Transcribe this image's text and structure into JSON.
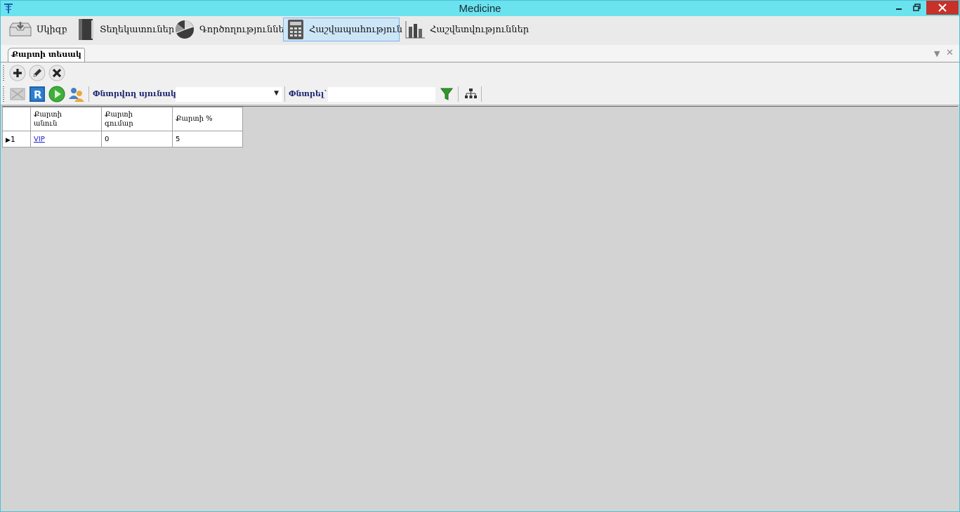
{
  "window": {
    "title": "Medicine",
    "accent_color": "#6ae3ee",
    "close_color": "#c7312a"
  },
  "menu": {
    "items": [
      {
        "label": "Սկիզբ",
        "icon": "home-tray-icon"
      },
      {
        "label": "Տեղեկատուներ",
        "icon": "book-icon"
      },
      {
        "label": "Գործողություններ",
        "icon": "pie-chart-icon"
      },
      {
        "label": "Հաշվապահություն",
        "icon": "calculator-icon",
        "active": true
      },
      {
        "label": "Հաշվետվություններ",
        "icon": "bar-chart-icon"
      }
    ]
  },
  "tabs": [
    {
      "label": "Քարտի տեսակ",
      "active": true
    }
  ],
  "toolbar1": {
    "buttons": [
      "add-icon",
      "edit-icon",
      "delete-icon"
    ]
  },
  "toolbar2": {
    "search_column_label": "Փնտրվող սյունակ`",
    "search_column_value": "",
    "search_label": "Փնտրել`",
    "search_value": ""
  },
  "grid": {
    "columns": [
      "Քարտի\nանուն",
      "Քարտի\nգումար",
      "Քարտի %"
    ],
    "rows": [
      {
        "index": "1",
        "cells": [
          "VIP",
          "0",
          "5"
        ]
      }
    ]
  }
}
